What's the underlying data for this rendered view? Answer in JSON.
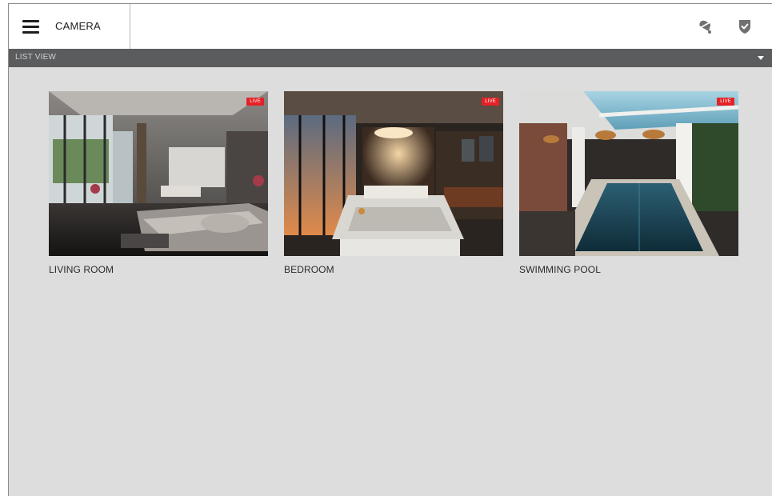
{
  "header": {
    "title": "CAMERA",
    "menu_icon": "hamburger-menu-icon",
    "actions": [
      {
        "icon": "alarm-bell-icon"
      },
      {
        "icon": "shield-check-icon"
      }
    ]
  },
  "view_selector": {
    "label": "LIST VIEW",
    "caret_icon": "caret-down-icon"
  },
  "cameras": [
    {
      "name": "LIVING ROOM",
      "badge": "LIVE"
    },
    {
      "name": "BEDROOM",
      "badge": "LIVE"
    },
    {
      "name": "SWIMMING POOL",
      "badge": "LIVE"
    }
  ],
  "colors": {
    "background": "#dcdddc",
    "header": "#ffffff",
    "subbar": "#5b5c5d",
    "live_badge": "#e42126",
    "icon": "#707070"
  }
}
